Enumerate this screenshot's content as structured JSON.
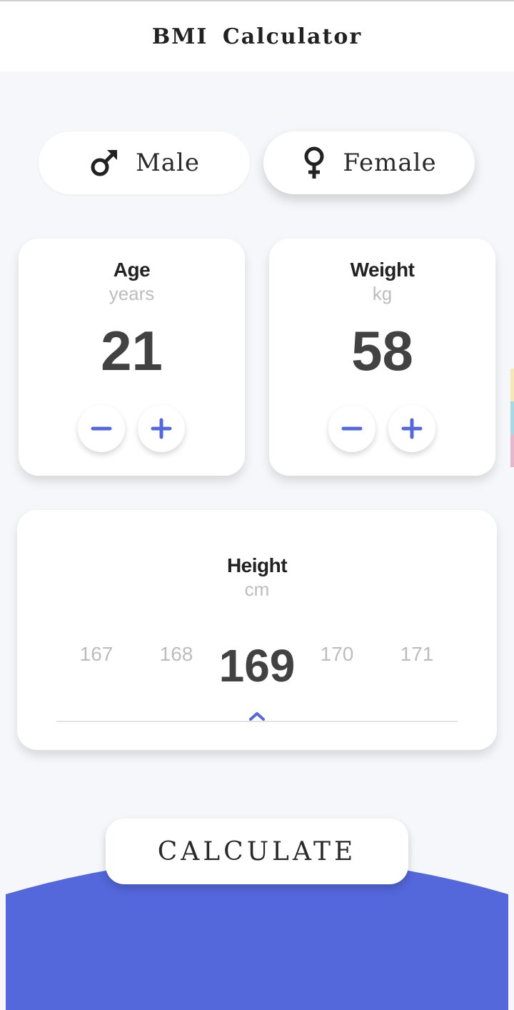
{
  "app": {
    "title": "BMI Calculator"
  },
  "gender": {
    "male_label": "Male",
    "female_label": "Female",
    "selected": "female"
  },
  "age": {
    "title": "Age",
    "unit": "years",
    "value": "21"
  },
  "weight": {
    "title": "Weight",
    "unit": "kg",
    "value": "58"
  },
  "height": {
    "title": "Height",
    "unit": "cm",
    "ticks": [
      "167",
      "168",
      "169",
      "170",
      "171"
    ],
    "selected_value": "169"
  },
  "calculate": {
    "label": "CALCULATE"
  },
  "icons": {
    "male": "male-symbol-icon",
    "female": "female-symbol-icon",
    "minus": "minus-icon",
    "plus": "plus-icon",
    "indicator": "chevron-up-icon"
  },
  "colors": {
    "accent": "#5468dc",
    "background": "#f5f7fb",
    "card": "#ffffff",
    "value_text": "#424242",
    "muted_text": "#bdbdbd",
    "edge_strip_1": "#f5e6b8",
    "edge_strip_2": "#a9d8e3",
    "edge_strip_3": "#e5b8cf"
  }
}
